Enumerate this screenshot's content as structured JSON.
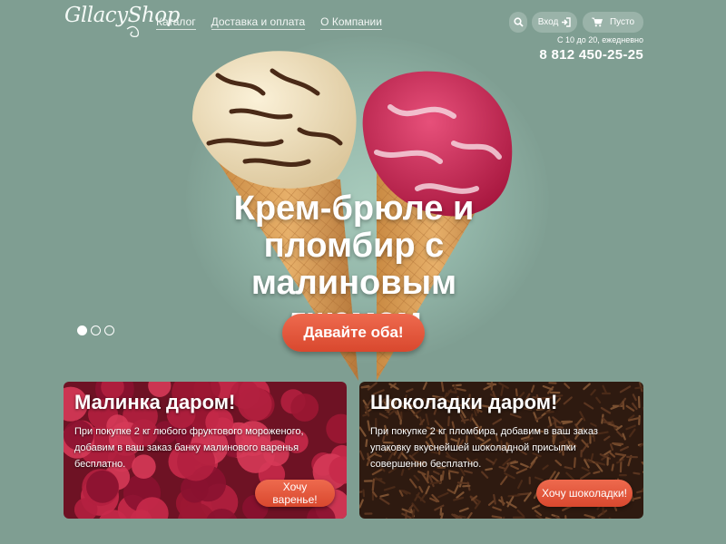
{
  "header": {
    "logo": "GllacyShop",
    "nav": [
      "Каталог",
      "Доставка и оплата",
      "О Компании"
    ],
    "login_label": "Вход",
    "cart_label": "Пусто",
    "hours": "С 10 до 20, ежедневно",
    "phone": "8 812 450-25-25"
  },
  "hero": {
    "title_line1": "Крем-брюле и",
    "title_line2": "пломбир с",
    "title_line3": "малиновым джемом",
    "cta_label": "Давайте оба!",
    "slides_total": 3,
    "slide_active": 1
  },
  "promos": {
    "raspberry": {
      "title": "Малинка даром!",
      "text": "При покупке 2 кг любого фруктового мороженого, добавим в ваш заказ банку малинового варенья бесплатно.",
      "button": "Хочу варенье!"
    },
    "chocolate": {
      "title": "Шоколадки даром!",
      "text": "При покупке 2 кг пломбира, добавим в ваш заказ упаковку вкуснейшей шоколадной присыпки совершенно бесплатно.",
      "button": "Хочу шоколадки!"
    }
  },
  "colors": {
    "background": "#7f9e92",
    "accent": "#e4553a"
  },
  "icons": [
    "search-icon",
    "login-icon",
    "cart-icon"
  ]
}
